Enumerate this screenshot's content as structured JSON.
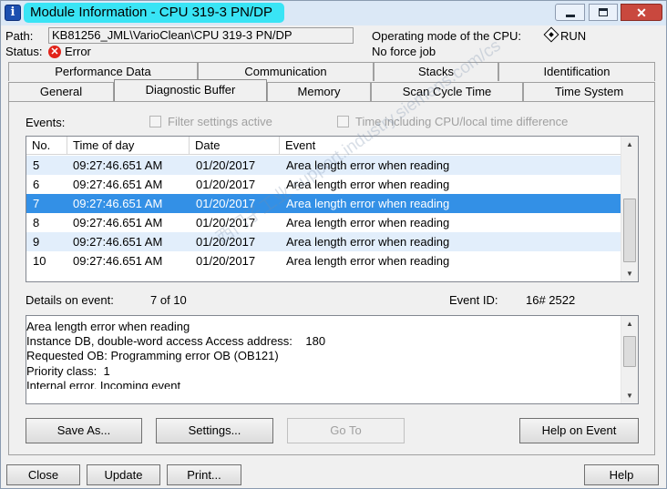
{
  "window": {
    "title": "Module Information - CPU 319-3 PN/DP",
    "icon_glyph": "i",
    "controls": {
      "close_glyph": "✕"
    }
  },
  "header": {
    "path_label": "Path:",
    "path_value": "KB81256_JML\\VarioClean\\CPU 319-3 PN/DP",
    "status_label": "Status:",
    "status_value": "Error",
    "operating_mode_label": "Operating mode of the  CPU:",
    "operating_mode_value": "RUN",
    "force_job": "No force job"
  },
  "tabs": {
    "row1": [
      "Performance Data",
      "Communication",
      "Stacks",
      "Identification"
    ],
    "row2": [
      "General",
      "Diagnostic Buffer",
      "Memory",
      "Scan Cycle Time",
      "Time System"
    ],
    "active": "Diagnostic Buffer"
  },
  "events": {
    "label": "Events:",
    "filter_label": "Filter settings active",
    "time_label": "Time including CPU/local time difference",
    "columns": [
      "No.",
      "Time of day",
      "Date",
      "Event"
    ],
    "rows": [
      {
        "no": "5",
        "time": "09:27:46.651 AM",
        "date": "01/20/2017",
        "event": "Area length error when reading"
      },
      {
        "no": "6",
        "time": "09:27:46.651 AM",
        "date": "01/20/2017",
        "event": "Area length error when reading"
      },
      {
        "no": "7",
        "time": "09:27:46.651 AM",
        "date": "01/20/2017",
        "event": "Area length error when reading"
      },
      {
        "no": "8",
        "time": "09:27:46.651 AM",
        "date": "01/20/2017",
        "event": "Area length error when reading"
      },
      {
        "no": "9",
        "time": "09:27:46.651 AM",
        "date": "01/20/2017",
        "event": "Area length error when reading"
      },
      {
        "no": "10",
        "time": "09:27:46.651 AM",
        "date": "01/20/2017",
        "event": "Area length error when reading"
      }
    ],
    "selected_no": "7"
  },
  "details": {
    "label": "Details on event:",
    "position": "7 of 10",
    "event_id_label": "Event ID:",
    "event_id_value": "16# 2522",
    "text": "Area length error when reading\nInstance DB, double-word access Access address:    180\nRequested OB: Programming error OB (OB121)\nPriority class:  1\nInternal error, Incoming event"
  },
  "buttons": {
    "save_as": "Save As...",
    "settings": "Settings...",
    "go_to": "Go To",
    "help_on_event": "Help on Event",
    "close": "Close",
    "update": "Update",
    "print": "Print...",
    "help": "Help"
  },
  "watermark": "西门子工业 support.industry.siemens.com/cs",
  "colors": {
    "title_highlight": "#39e4f5",
    "selection": "#3390e6",
    "alt_row": "#e2eefb",
    "error_red": "#e2231a"
  }
}
